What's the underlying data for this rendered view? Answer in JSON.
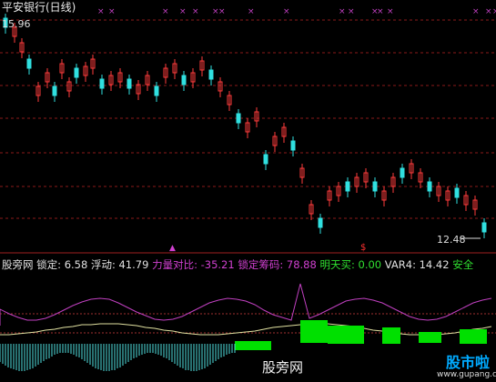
{
  "window": {
    "title": "平安银行(日线)"
  },
  "price": {
    "high_label": "15.96",
    "low_label": "12.48"
  },
  "indicator": {
    "name": "股旁网",
    "items": [
      {
        "label": "锁定",
        "value": "6.58",
        "color": "#e0e0e0"
      },
      {
        "label": "浮动",
        "value": "41.79",
        "color": "#e0e0e0"
      },
      {
        "label": "力量对比",
        "value": "-35.21",
        "color": "#d040d0"
      },
      {
        "label": "锁定筹码",
        "value": "78.88",
        "color": "#d040d0"
      },
      {
        "label": "明天买",
        "value": "0.00",
        "color": "#30e030"
      },
      {
        "label": "VAR4",
        "value": "14.42",
        "color": "#e0e0e0"
      }
    ],
    "signal": "安全",
    "signal_color": "#30e030"
  },
  "watermark": {
    "text": "股旁网",
    "logo": "股市啦",
    "site": "www.gupang.com"
  },
  "colors": {
    "up": "#ff3c3c",
    "down": "#30e0e0",
    "grid": "#8b1a1a",
    "purple": "#c040c0",
    "green": "#00e000"
  }
}
